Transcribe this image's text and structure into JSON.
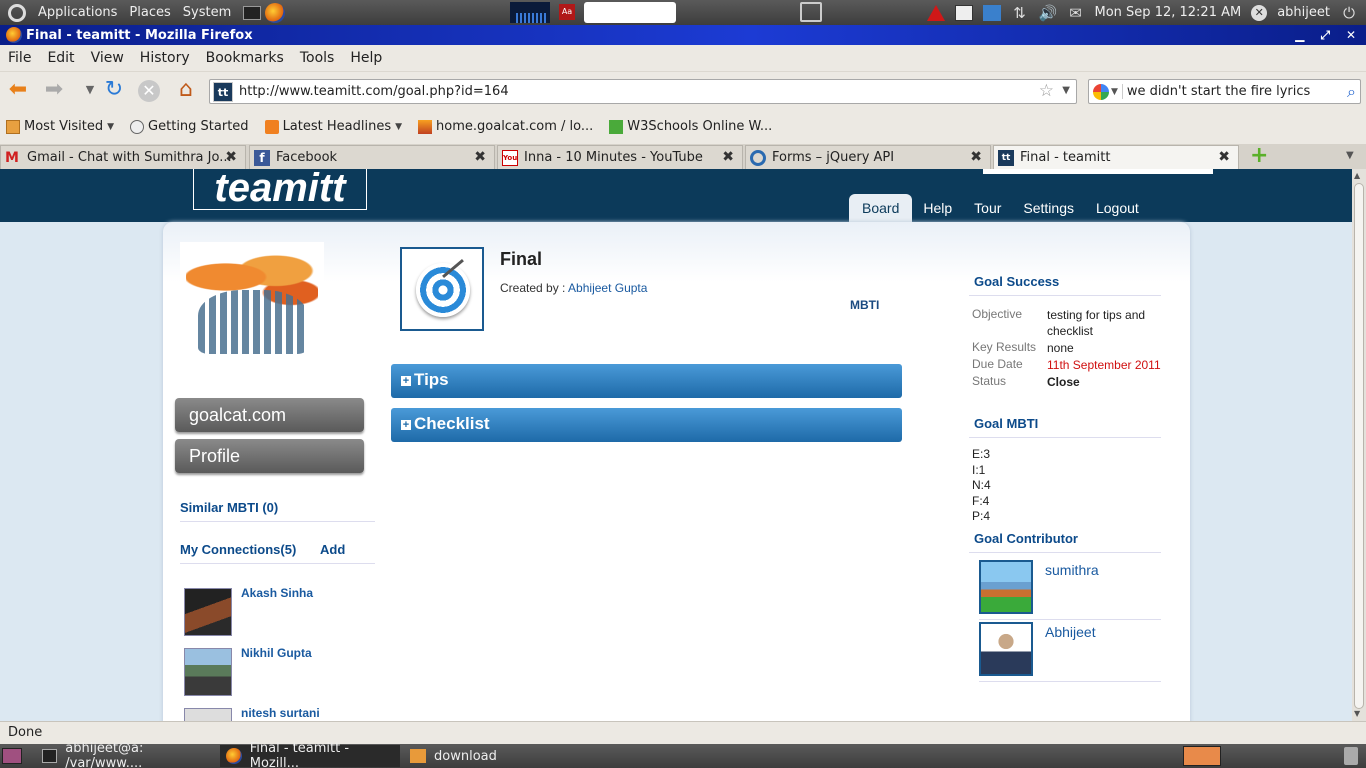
{
  "gnome_top": {
    "menus": [
      "Applications",
      "Places",
      "System"
    ],
    "clock": "Mon Sep 12, 12:21 AM",
    "user": "abhijeet"
  },
  "window": {
    "title": "Final - teamitt - Mozilla Firefox"
  },
  "menubar": [
    "File",
    "Edit",
    "View",
    "History",
    "Bookmarks",
    "Tools",
    "Help"
  ],
  "navbar": {
    "url": "http://www.teamitt.com/goal.php?id=164",
    "search_value": "we didn't start the fire lyrics",
    "site_icon_text": "tt"
  },
  "bookmarks": [
    {
      "label": "Most Visited",
      "icon": "folder-icon"
    },
    {
      "label": "Getting Started",
      "icon": "page-icon"
    },
    {
      "label": "Latest Headlines",
      "icon": "rss-icon"
    },
    {
      "label": "home.goalcat.com / lo...",
      "icon": "pma-icon"
    },
    {
      "label": "W3Schools Online W...",
      "icon": "w3-icon"
    }
  ],
  "tabs": [
    {
      "label": "Gmail - Chat with Sumithra Jo...",
      "icon": "gmail-icon",
      "icon_text": "M"
    },
    {
      "label": "Facebook",
      "icon": "facebook-icon",
      "icon_text": "f"
    },
    {
      "label": "Inna - 10 Minutes - YouTube",
      "icon": "youtube-icon",
      "icon_text": "You"
    },
    {
      "label": "Forms – jQuery API",
      "icon": "jquery-icon",
      "icon_text": ""
    },
    {
      "label": "Final - teamitt",
      "icon": "teamitt-icon",
      "icon_text": "tt"
    }
  ],
  "site": {
    "logo": "teamitt",
    "nav": [
      "Board",
      "Help",
      "Tour",
      "Settings",
      "Logout"
    ],
    "active_nav": "Board"
  },
  "left": {
    "buttons": [
      "goalcat.com",
      "Profile"
    ],
    "similar_mbti": "Similar MBTI (0)",
    "connections_label": "My Connections(5)",
    "add_label": "Add",
    "connections": [
      "Akash Sinha",
      "Nikhil Gupta",
      "nitesh surtani"
    ]
  },
  "goal": {
    "title": "Final",
    "created_by_label": "Created by : ",
    "creator": "Abhijeet Gupta",
    "mbti_link": "MBTI",
    "sections": [
      "Tips",
      "Checklist"
    ]
  },
  "right": {
    "goal_success_head": "Goal Success",
    "details": [
      {
        "key": "Objective",
        "value": "testing for tips and checklist"
      },
      {
        "key": "Key Results",
        "value": "none"
      },
      {
        "key": "Due Date",
        "value": "11th September 2011"
      },
      {
        "key": "Status",
        "value": "Close"
      }
    ],
    "goal_mbti_head": "Goal MBTI",
    "mbti": [
      "E:3",
      "I:1",
      "N:4",
      "F:4",
      "P:4"
    ],
    "contributor_head": "Goal Contributor",
    "contributors": [
      "sumithra",
      "Abhijeet"
    ]
  },
  "statusbar": "Done",
  "taskbar": [
    {
      "label": "abhijeet@a: /var/www...."
    },
    {
      "label": "Final - teamitt - Mozill..."
    },
    {
      "label": "download"
    }
  ],
  "colors": {
    "header_bg": "#0c3a5a",
    "accordion": "#1e6aa8",
    "link": "#1a5aa0",
    "due_date": "#d01010"
  }
}
